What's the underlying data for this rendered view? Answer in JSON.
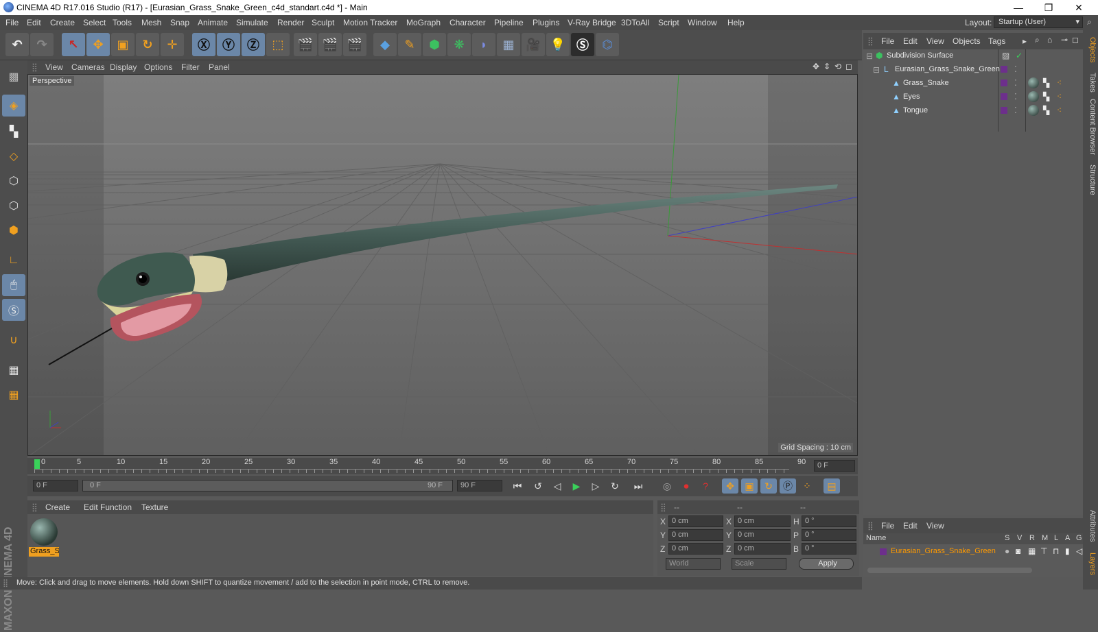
{
  "window": {
    "title": "CINEMA 4D R17.016 Studio (R17) - [Eurasian_Grass_Snake_Green_c4d_standart.c4d *] - Main",
    "minimize": "—",
    "restore": "❐",
    "close": "✕"
  },
  "menu": [
    "File",
    "Edit",
    "Create",
    "Select",
    "Tools",
    "Mesh",
    "Snap",
    "Animate",
    "Simulate",
    "Render",
    "Sculpt",
    "Motion Tracker",
    "MoGraph",
    "Character",
    "Pipeline",
    "Plugins",
    "V-Ray Bridge",
    "3DToAll",
    "Script",
    "Window",
    "Help"
  ],
  "layout": {
    "label": "Layout:",
    "value": "Startup (User)"
  },
  "viewport": {
    "menu": [
      "View",
      "Cameras",
      "Display",
      "Options",
      "Filter",
      "Panel"
    ],
    "label": "Perspective",
    "grid_spacing": "Grid Spacing : 10 cm"
  },
  "timeline": {
    "ticks": [
      "0",
      "5",
      "10",
      "15",
      "20",
      "25",
      "30",
      "35",
      "40",
      "45",
      "50",
      "55",
      "60",
      "65",
      "70",
      "75",
      "80",
      "85",
      "90"
    ],
    "current_frame": "0 F",
    "start_field": "0 F",
    "range_start": "0 F",
    "range_end": "90 F",
    "end_field": "90 F"
  },
  "material_manager": {
    "menu": [
      "Create",
      "Edit",
      "Function",
      "Texture"
    ],
    "materials": [
      {
        "name": "Grass_Sn"
      }
    ]
  },
  "coordinates": {
    "headers": [
      "--",
      "--",
      "--"
    ],
    "rows": [
      {
        "a": "X",
        "a_val": "0 cm",
        "b": "X",
        "b_val": "0 cm",
        "c": "H",
        "c_val": "0 °"
      },
      {
        "a": "Y",
        "a_val": "0 cm",
        "b": "Y",
        "b_val": "0 cm",
        "c": "P",
        "c_val": "0 °"
      },
      {
        "a": "Z",
        "a_val": "0 cm",
        "b": "Z",
        "b_val": "0 cm",
        "c": "B",
        "c_val": "0 °"
      }
    ],
    "mode": "World",
    "scale": "Scale",
    "apply": "Apply"
  },
  "status": "Move: Click and drag to move elements. Hold down SHIFT to quantize movement / add to the selection in point mode, CTRL to remove.",
  "object_manager": {
    "menu": [
      "File",
      "Edit",
      "View",
      "Objects",
      "Tags"
    ],
    "objects": [
      {
        "name": "Subdivision Surface"
      },
      {
        "name": "Eurasian_Grass_Snake_Green"
      },
      {
        "name": "Grass_Snake"
      },
      {
        "name": "Eyes"
      },
      {
        "name": "Tongue"
      }
    ]
  },
  "layer_manager": {
    "menu": [
      "File",
      "Edit",
      "View"
    ],
    "columns": [
      "Name",
      "S",
      "V",
      "R",
      "M",
      "L",
      "A",
      "G"
    ],
    "layer": "Eurasian_Grass_Snake_Green"
  },
  "right_tabs": [
    "Objects",
    "Takes",
    "Content Browser",
    "Structure",
    "Attributes",
    "Layers"
  ],
  "maxon_logo": "MAXON CINEMA 4D",
  "colors": {
    "accent": "#6b87a8",
    "selection": "#ff9a00",
    "layer_purple": "#6d2f8c"
  }
}
